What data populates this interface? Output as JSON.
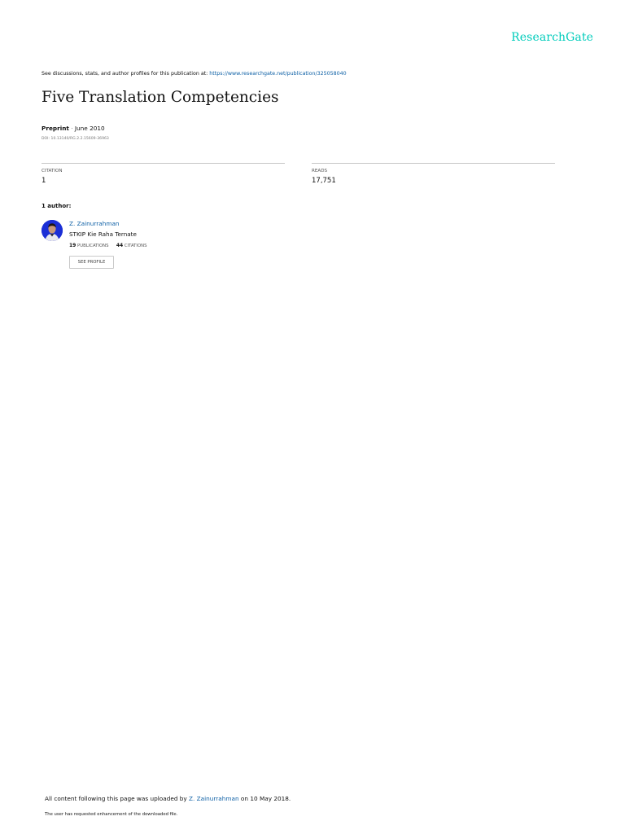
{
  "brand": {
    "name": "ResearchGate",
    "color": "#00ccbb"
  },
  "discussion": {
    "prefix": "See discussions, stats, and author profiles for this publication at: ",
    "link_text": "https://www.researchgate.net/publication/325058040"
  },
  "publication": {
    "title": "Five Translation Competencies",
    "type": "Preprint",
    "separator": " · ",
    "date": "June 2010",
    "doi": "DOI: 10.13140/RG.2.2.15609-36963"
  },
  "stats": {
    "citation": {
      "label": "CITATION",
      "value": "1"
    },
    "reads": {
      "label": "READS",
      "value": "17,751"
    }
  },
  "authors": {
    "heading": "1 author:",
    "items": [
      {
        "name": "Z. Zainurrahman",
        "institution": "STKIP Kie Raha Ternate",
        "publications_count": "19",
        "publications_label": "PUBLICATIONS",
        "citations_count": "44",
        "citations_label": "CITATIONS",
        "profile_button": "SEE PROFILE"
      }
    ]
  },
  "footer": {
    "uploaded_prefix": "All content following this page was uploaded by ",
    "uploader": "Z. Zainurrahman",
    "uploaded_suffix": " on 10 May 2018.",
    "note": "The user has requested enhancement of the downloaded file."
  },
  "colors": {
    "link": "#0c5fa5",
    "text": "#111111",
    "rule": "#c6c6c6"
  }
}
